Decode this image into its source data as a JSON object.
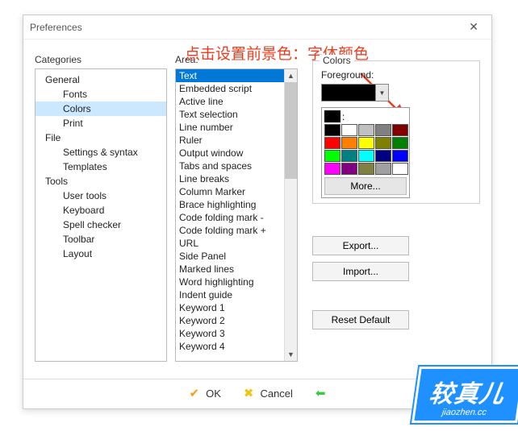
{
  "dialog": {
    "title": "Preferences"
  },
  "annotation": "点击设置前景色：字体颜色",
  "categories": {
    "label": "Categories",
    "tree": [
      {
        "label": "General",
        "children": [
          "Fonts",
          "Colors",
          "Print"
        ],
        "selected_child": "Colors"
      },
      {
        "label": "File",
        "children": [
          "Settings & syntax",
          "Templates"
        ]
      },
      {
        "label": "Tools",
        "children": [
          "User tools",
          "Keyboard",
          "Spell checker",
          "Toolbar",
          "Layout"
        ]
      }
    ]
  },
  "area": {
    "label": "Area:",
    "selected": "Text",
    "items": [
      "Text",
      "Embedded script",
      "Active line",
      "Text selection",
      "Line number",
      "Ruler",
      "Output window",
      "Tabs and spaces",
      "Line breaks",
      "Column Marker",
      "Brace highlighting",
      "Code folding mark -",
      "Code folding mark +",
      "URL",
      "Side Panel",
      "Marked lines",
      "Word highlighting",
      "Indent guide",
      "Keyword 1",
      "Keyword 2",
      "Keyword 3",
      "Keyword 4"
    ]
  },
  "colors": {
    "group_label": "Colors",
    "foreground_label": "Foreground:",
    "foreground_value": "#000000",
    "palette_divider": ":",
    "palette": [
      "#000000",
      "#ffffff",
      "#c0c0c0",
      "#808080",
      "#800000",
      "#ff0000",
      "#ff8000",
      "#ffff00",
      "#808000",
      "#008000",
      "#00ff00",
      "#008080",
      "#00ffff",
      "#000080",
      "#0000ff",
      "#ff00ff",
      "#800080",
      "#808040",
      "#a0a0a0",
      "#ffffff"
    ],
    "more_label": "More..."
  },
  "buttons": {
    "export": "Export...",
    "import": "Import...",
    "reset": "Reset Default",
    "ok": "OK",
    "cancel": "Cancel"
  },
  "watermark": {
    "main": "较真儿",
    "sub": "jiaozhen.cc"
  }
}
